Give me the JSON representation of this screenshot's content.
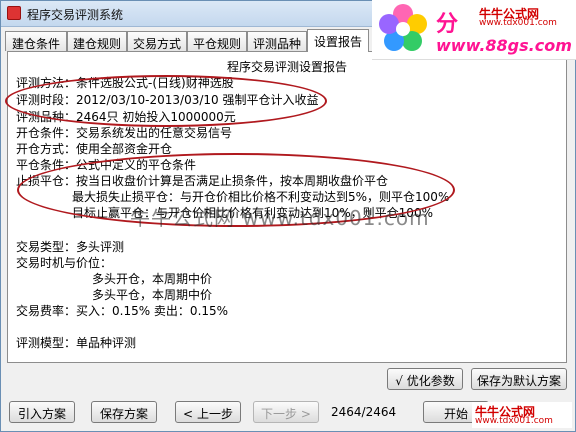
{
  "window": {
    "title": "程序交易评测系统"
  },
  "tabs": [
    "建仓条件",
    "建仓规则",
    "交易方式",
    "平仓规则",
    "评测品种",
    "设置报告"
  ],
  "report": {
    "title": "程序交易评测设置报告",
    "lines": [
      "评测方法：条件选股公式-(日线)财神选股",
      "评测时段：2012/03/10-2013/03/10 强制平仓计入收益",
      "评测品种：2464只 初始投入1000000元",
      "开仓条件：交易系统发出的任意交易信号",
      "开仓方式：使用全部资金开仓",
      "平仓条件：公式中定义的平仓条件",
      "止损平仓：按当日收盘价计算是否满足止损条件，按本周期收盘价平仓",
      "最大损失止损平仓：与开仓价相比价格不利变动达到5%，则平仓100%",
      "目标止赢平仓：与开仓价相比价格有利变动达到10%，则平仓100%",
      "交易类型：多头评测",
      "交易时机与价位：",
      "多头开仓，本周期中价",
      "多头平仓，本周期中价",
      "交易费率：买入：0.15%   卖出：0.15%",
      "评测模型：单品种评测"
    ]
  },
  "buttons": {
    "optimize": "优化参数",
    "optimize_icon": "√",
    "save_default": "保存为默认方案",
    "import": "引入方案",
    "save": "保存方案",
    "prev": "上一步",
    "next": "下一步",
    "start": "开始"
  },
  "counter": "2464/2464",
  "watermark": {
    "logo_big": "分",
    "logo_url": "www.88gs.com",
    "badge_top": "牛牛公式网",
    "badge_bottom": "www.tdx001.com",
    "overlay": "牛牛公式网 www.tdx001.com"
  },
  "colors": {
    "annotation": "#b0191e",
    "brand": "#ff1493",
    "badge": "#d20000"
  }
}
